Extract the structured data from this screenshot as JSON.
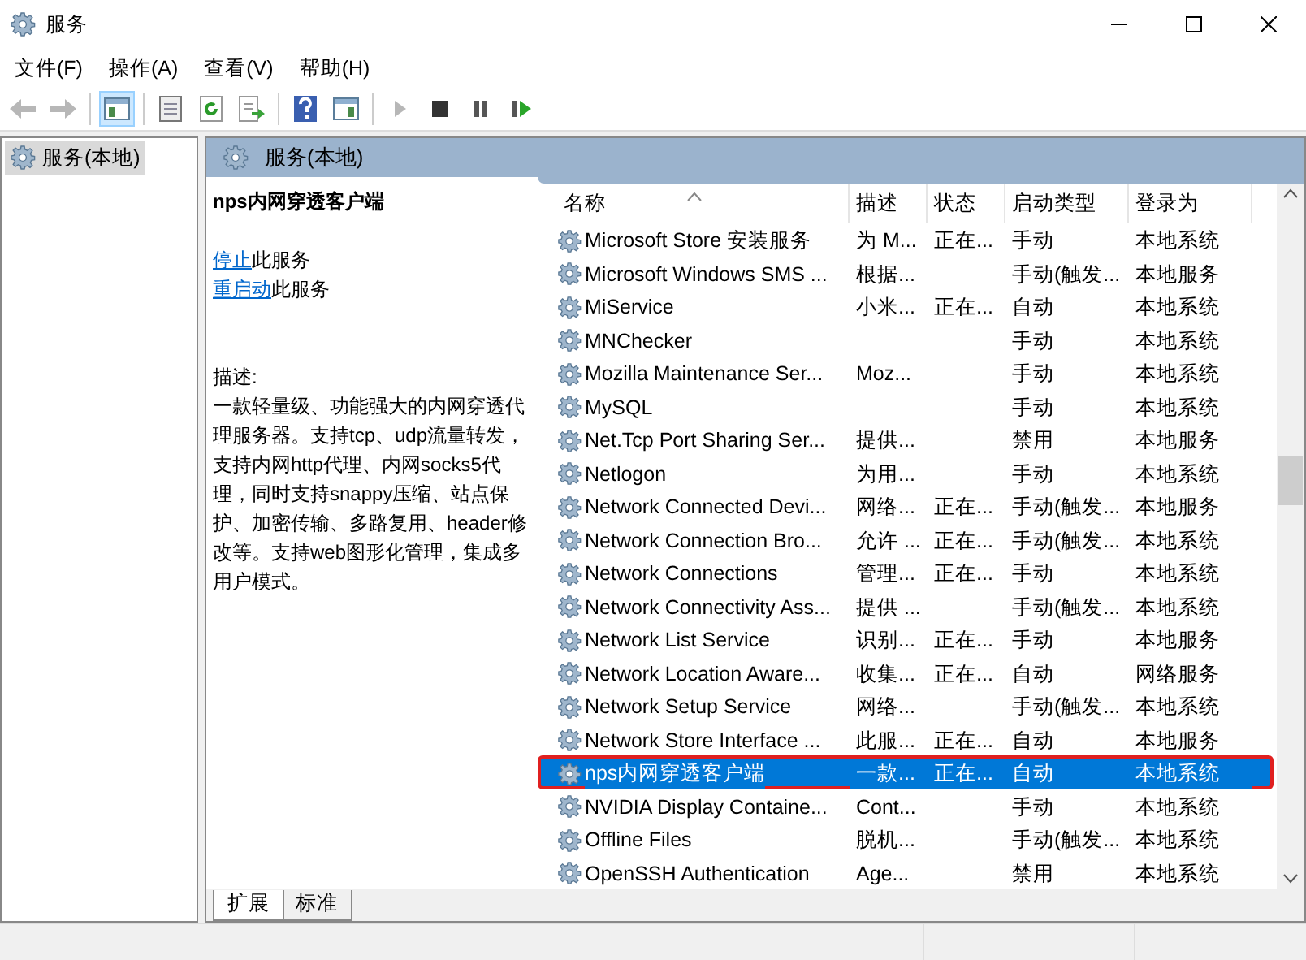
{
  "window": {
    "title": "服务"
  },
  "menu": [
    {
      "label": "文件(F)"
    },
    {
      "label": "操作(A)"
    },
    {
      "label": "查看(V)"
    },
    {
      "label": "帮助(H)"
    }
  ],
  "toolbar": [
    {
      "kind": "back",
      "disabled": true,
      "selected": false
    },
    {
      "kind": "forward",
      "disabled": true,
      "selected": false
    },
    {
      "kind": "sep"
    },
    {
      "kind": "tree",
      "disabled": false,
      "selected": true
    },
    {
      "kind": "sep"
    },
    {
      "kind": "properties",
      "disabled": false,
      "selected": false
    },
    {
      "kind": "refresh",
      "disabled": false,
      "selected": false
    },
    {
      "kind": "export",
      "disabled": false,
      "selected": false
    },
    {
      "kind": "sep"
    },
    {
      "kind": "help",
      "disabled": false,
      "selected": false
    },
    {
      "kind": "pane",
      "disabled": false,
      "selected": false
    },
    {
      "kind": "sep"
    },
    {
      "kind": "start",
      "disabled": true,
      "selected": false
    },
    {
      "kind": "stop",
      "disabled": false,
      "selected": false
    },
    {
      "kind": "pause",
      "disabled": false,
      "selected": false
    },
    {
      "kind": "resume",
      "disabled": false,
      "selected": false
    }
  ],
  "tree": [
    {
      "label": "服务(本地)",
      "selected": true
    }
  ],
  "panel": {
    "title": "服务(本地)"
  },
  "details": {
    "service_name": "nps内网穿透客户端",
    "actions": [
      {
        "link": "停止",
        "text": "此服务"
      },
      {
        "link": "重启动",
        "text": "此服务"
      }
    ],
    "description_label": "描述:",
    "description": "一款轻量级、功能强大的内网穿透代理服务器。支持tcp、udp流量转发，支持内网http代理、内网socks5代理，同时支持snappy压缩、站点保护、加密传输、多路复用、header修改等。支持web图形化管理，集成多用户模式。"
  },
  "table": {
    "columns": [
      {
        "label": "名称",
        "sorted": true
      },
      {
        "label": "描述",
        "sorted": false
      },
      {
        "label": "状态",
        "sorted": false
      },
      {
        "label": "启动类型",
        "sorted": false
      },
      {
        "label": "登录为",
        "sorted": false
      }
    ],
    "rows": [
      {
        "name": "Microsoft Store 安装服务",
        "description": "为 M...",
        "status": "正在...",
        "startup": "手动",
        "logon": "本地系统",
        "selected": false,
        "annotated": false
      },
      {
        "name": "Microsoft Windows SMS ...",
        "description": "根据...",
        "status": "",
        "startup": "手动(触发...",
        "logon": "本地服务",
        "selected": false,
        "annotated": false
      },
      {
        "name": "MiService",
        "description": "小米...",
        "status": "正在...",
        "startup": "自动",
        "logon": "本地系统",
        "selected": false,
        "annotated": false
      },
      {
        "name": "MNChecker",
        "description": "",
        "status": "",
        "startup": "手动",
        "logon": "本地系统",
        "selected": false,
        "annotated": false
      },
      {
        "name": "Mozilla Maintenance Ser...",
        "description": "Moz...",
        "status": "",
        "startup": "手动",
        "logon": "本地系统",
        "selected": false,
        "annotated": false
      },
      {
        "name": "MySQL",
        "description": "",
        "status": "",
        "startup": "手动",
        "logon": "本地系统",
        "selected": false,
        "annotated": false
      },
      {
        "name": "Net.Tcp Port Sharing Ser...",
        "description": "提供...",
        "status": "",
        "startup": "禁用",
        "logon": "本地服务",
        "selected": false,
        "annotated": false
      },
      {
        "name": "Netlogon",
        "description": "为用...",
        "status": "",
        "startup": "手动",
        "logon": "本地系统",
        "selected": false,
        "annotated": false
      },
      {
        "name": "Network Connected Devi...",
        "description": "网络...",
        "status": "正在...",
        "startup": "手动(触发...",
        "logon": "本地服务",
        "selected": false,
        "annotated": false
      },
      {
        "name": "Network Connection Bro...",
        "description": "允许 ...",
        "status": "正在...",
        "startup": "手动(触发...",
        "logon": "本地系统",
        "selected": false,
        "annotated": false
      },
      {
        "name": "Network Connections",
        "description": "管理...",
        "status": "正在...",
        "startup": "手动",
        "logon": "本地系统",
        "selected": false,
        "annotated": false
      },
      {
        "name": "Network Connectivity Ass...",
        "description": "提供 ...",
        "status": "",
        "startup": "手动(触发...",
        "logon": "本地系统",
        "selected": false,
        "annotated": false
      },
      {
        "name": "Network List Service",
        "description": "识别...",
        "status": "正在...",
        "startup": "手动",
        "logon": "本地服务",
        "selected": false,
        "annotated": false
      },
      {
        "name": "Network Location Aware...",
        "description": "收集...",
        "status": "正在...",
        "startup": "自动",
        "logon": "网络服务",
        "selected": false,
        "annotated": false
      },
      {
        "name": "Network Setup Service",
        "description": "网络...",
        "status": "",
        "startup": "手动(触发...",
        "logon": "本地系统",
        "selected": false,
        "annotated": false
      },
      {
        "name": "Network Store Interface ...",
        "description": "此服...",
        "status": "正在...",
        "startup": "自动",
        "logon": "本地服务",
        "selected": false,
        "annotated": false
      },
      {
        "name": "nps内网穿透客户端",
        "description": "一款...",
        "status": "正在...",
        "startup": "自动",
        "logon": "本地系统",
        "selected": true,
        "annotated": true
      },
      {
        "name": "NVIDIA Display Containe...",
        "description": "Cont...",
        "status": "",
        "startup": "手动",
        "logon": "本地系统",
        "selected": false,
        "annotated": false
      },
      {
        "name": "Offline Files",
        "description": "脱机...",
        "status": "",
        "startup": "手动(触发...",
        "logon": "本地系统",
        "selected": false,
        "annotated": false
      },
      {
        "name": "OpenSSH Authentication",
        "description": "Age...",
        "status": "",
        "startup": "禁用",
        "logon": "本地系统",
        "selected": false,
        "annotated": false
      }
    ]
  },
  "view_tabs": [
    {
      "label": "扩展",
      "selected": true
    },
    {
      "label": "标准",
      "selected": false
    }
  ]
}
